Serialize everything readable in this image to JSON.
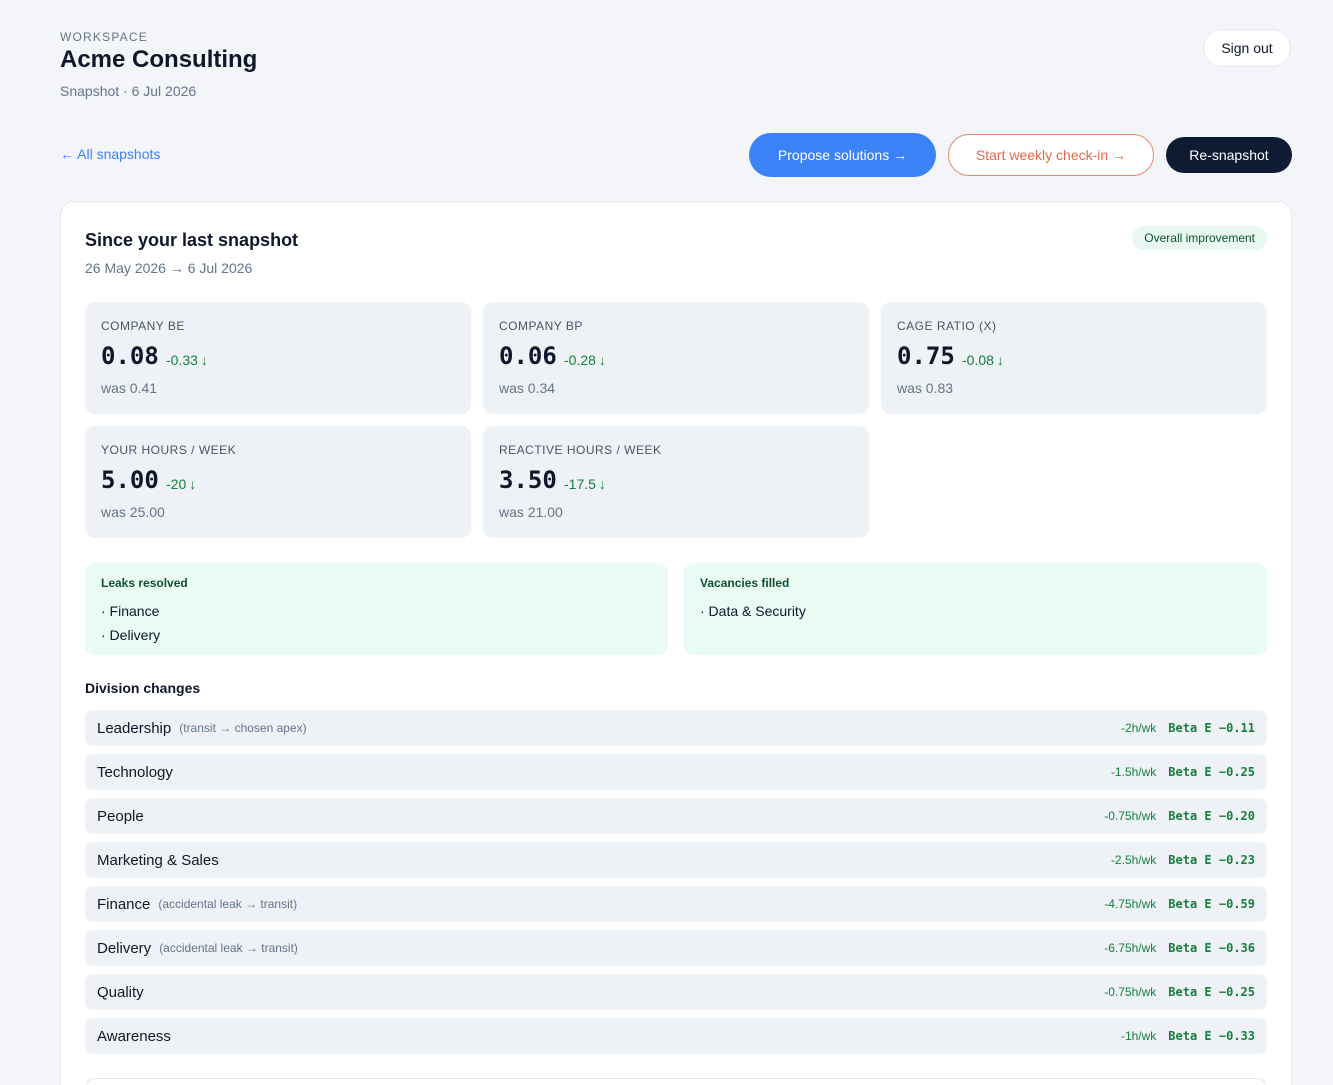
{
  "header": {
    "eyebrow": "WORKSPACE",
    "title": "Acme Consulting",
    "subtitle": "Snapshot · 6 Jul 2026",
    "signout_label": "Sign out"
  },
  "toolbar": {
    "back_label": "← All snapshots",
    "propose_label": "Propose solutions →",
    "checkin_label": "Start weekly check-in →",
    "resnapshot_label": "Re-snapshot"
  },
  "summary": {
    "title": "Since your last snapshot",
    "range": "26 May 2026 → 6 Jul 2026",
    "badge": "Overall improvement",
    "metrics": [
      {
        "label": "COMPANY BE",
        "value": "0.08",
        "delta": "-0.33",
        "was": "was 0.41"
      },
      {
        "label": "COMPANY BP",
        "value": "0.06",
        "delta": "-0.28",
        "was": "was 0.34"
      },
      {
        "label": "CAGE RATIO (X)",
        "value": "0.75",
        "delta": "-0.08",
        "was": "was 0.83"
      },
      {
        "label": "YOUR HOURS / WEEK",
        "value": "5.00",
        "delta": "-20",
        "was": "was 25.00"
      },
      {
        "label": "REACTIVE HOURS / WEEK",
        "value": "3.50",
        "delta": "-17.5",
        "was": "was 21.00"
      }
    ],
    "leaks": {
      "title": "Leaks resolved",
      "items": [
        "· Finance",
        "· Delivery"
      ]
    },
    "vacancies": {
      "title": "Vacancies filled",
      "items": [
        "· Data & Security"
      ]
    },
    "divisions_title": "Division changes",
    "divisions": [
      {
        "name": "Leadership",
        "note": "(transit → chosen apex)",
        "hours": "-2h/wk",
        "beta": "Beta E −0.11"
      },
      {
        "name": "Technology",
        "note": "",
        "hours": "-1.5h/wk",
        "beta": "Beta E −0.25"
      },
      {
        "name": "People",
        "note": "",
        "hours": "-0.75h/wk",
        "beta": "Beta E −0.20"
      },
      {
        "name": "Marketing & Sales",
        "note": "",
        "hours": "-2.5h/wk",
        "beta": "Beta E −0.23"
      },
      {
        "name": "Finance",
        "note": "(accidental leak → transit)",
        "hours": "-4.75h/wk",
        "beta": "Beta E −0.59"
      },
      {
        "name": "Delivery",
        "note": "(accidental leak → transit)",
        "hours": "-6.75h/wk",
        "beta": "Beta E −0.36"
      },
      {
        "name": "Quality",
        "note": "",
        "hours": "-0.75h/wk",
        "beta": "Beta E −0.25"
      },
      {
        "name": "Awareness",
        "note": "",
        "hours": "-1h/wk",
        "beta": "Beta E −0.33"
      }
    ]
  },
  "colors": {
    "accent": "#3b82f6",
    "positive": "#15803d",
    "checkin": "#e0694b",
    "dark_button": "#0f1b33"
  }
}
